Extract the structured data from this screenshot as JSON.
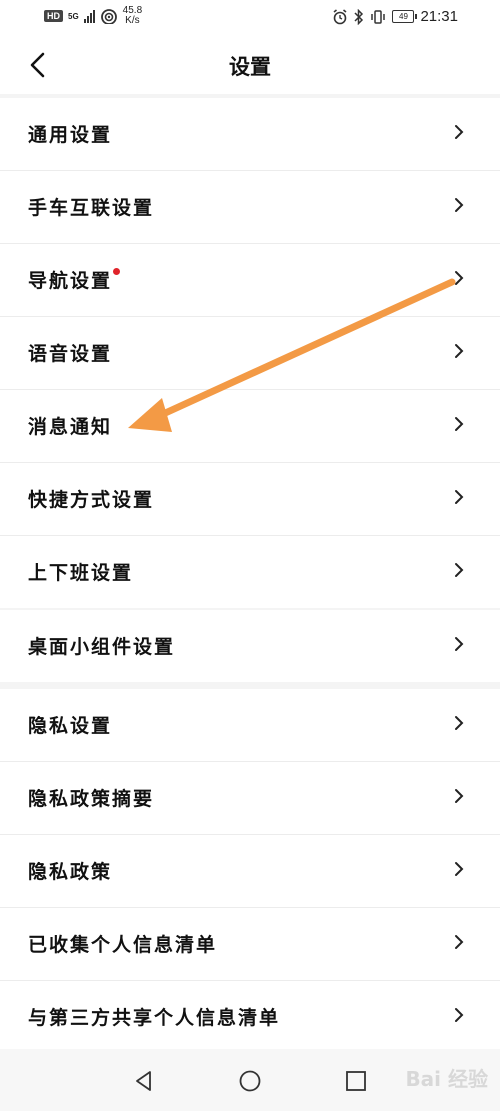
{
  "status_bar": {
    "hd": "HD",
    "net": "5G",
    "speed_value": "45.8",
    "speed_unit": "K/s",
    "battery": "49",
    "time": "21:31"
  },
  "header": {
    "title": "设置"
  },
  "groups": [
    {
      "items": [
        {
          "label": "通用设置"
        },
        {
          "label": "手车互联设置"
        },
        {
          "label": "导航设置",
          "badge": "red-dot"
        },
        {
          "label": "语音设置"
        },
        {
          "label": "消息通知"
        },
        {
          "label": "快捷方式设置"
        },
        {
          "label": "上下班设置"
        }
      ]
    },
    {
      "items": [
        {
          "label": "桌面小组件设置"
        }
      ]
    },
    {
      "items": [
        {
          "label": "隐私设置"
        },
        {
          "label": "隐私政策摘要"
        },
        {
          "label": "隐私政策"
        },
        {
          "label": "已收集个人信息清单"
        },
        {
          "label": "与第三方共享个人信息清单"
        }
      ]
    }
  ],
  "watermark": "Bai 经验",
  "colors": {
    "badge": "#e0242a",
    "annotation_arrow": "#f39a45"
  },
  "icons": [
    "back-arrow-icon",
    "chevron-right-icon",
    "nav-back-icon",
    "nav-home-icon",
    "nav-recents-icon"
  ]
}
